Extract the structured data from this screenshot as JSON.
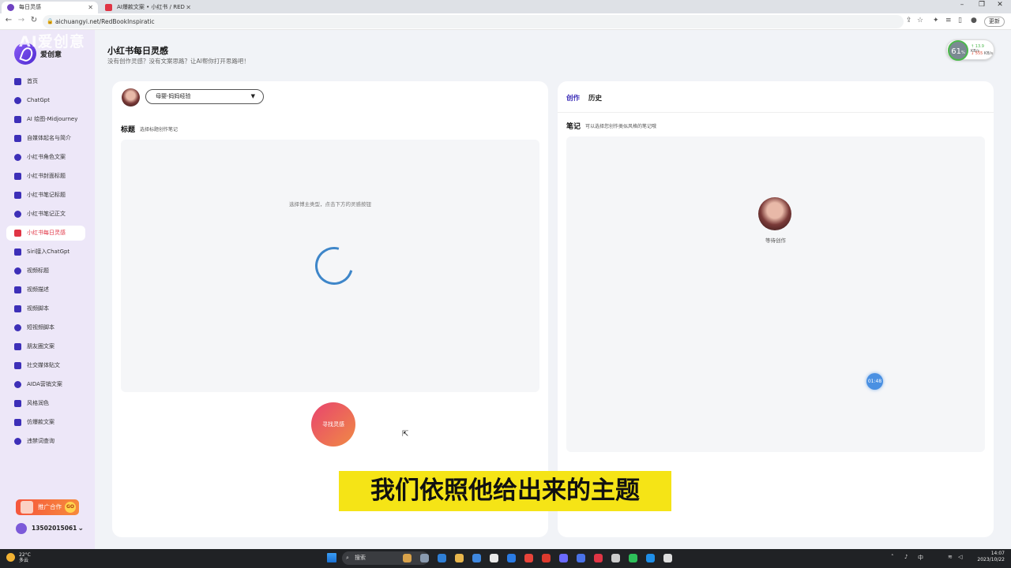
{
  "browser": {
    "tabs": [
      {
        "title": "每日灵感",
        "active": true,
        "icon_color": "#6f42c1"
      },
      {
        "title": "AI爆款文案 • 小红书 / RED",
        "active": false,
        "icon_color": "#e03545"
      }
    ],
    "url": "aichuangyi.net/RedBookInspiratic",
    "update_label": "更新"
  },
  "watermark": "AI爱创意",
  "sidebar": {
    "logo_text": "爱创意",
    "items": [
      {
        "label": "首页",
        "icon": "home-icon",
        "active": false
      },
      {
        "label": "ChatGpt",
        "icon": "chat-icon",
        "active": false
      },
      {
        "label": "AI 绘图-Midjourney",
        "icon": "image-icon",
        "active": false
      },
      {
        "label": "自媒体起名与简介",
        "icon": "pen-icon",
        "active": false
      },
      {
        "label": "小红书角色文案",
        "icon": "book-icon",
        "active": false
      },
      {
        "label": "小红书封面标题",
        "icon": "book-icon",
        "active": false
      },
      {
        "label": "小红书笔记标题",
        "icon": "book-icon",
        "active": false
      },
      {
        "label": "小红书笔记正文",
        "icon": "book-icon",
        "active": false
      },
      {
        "label": "小红书每日灵感",
        "icon": "book-icon",
        "active": true
      },
      {
        "label": "Siri接入ChatGpt",
        "icon": "siri-icon",
        "active": false
      },
      {
        "label": "视频标题",
        "icon": "video-icon",
        "active": false
      },
      {
        "label": "视频描述",
        "icon": "video-icon",
        "active": false
      },
      {
        "label": "视频脚本",
        "icon": "script-icon",
        "active": false
      },
      {
        "label": "短视频脚本",
        "icon": "play-icon",
        "active": false
      },
      {
        "label": "朋友圈文案",
        "icon": "moments-icon",
        "active": false
      },
      {
        "label": "社交媒体贴文",
        "icon": "social-icon",
        "active": false
      },
      {
        "label": "AIDA营销文案",
        "icon": "wifi-icon",
        "active": false
      },
      {
        "label": "风格润色",
        "icon": "wand-icon",
        "active": false
      },
      {
        "label": "仿爆款文案",
        "icon": "fire-icon",
        "active": false
      },
      {
        "label": "违禁词查询",
        "icon": "text-icon",
        "active": false
      }
    ],
    "promo_label": "推广合作",
    "promo_go": "GO",
    "user_phone": "13502015061"
  },
  "page": {
    "title": "小红书每日灵感",
    "subtitle": "没有创作灵感？没有文案思路？让AI帮你打开思路吧！"
  },
  "left_card": {
    "category_value": "母婴-妈妈经验",
    "title_label": "标题",
    "title_hint": "选择标题创作笔记",
    "placeholder": "选择博主类型，点击下方的灵感按钮",
    "find_button": "寻找灵感"
  },
  "right_card": {
    "tabs": [
      "创作",
      "历史"
    ],
    "note_label": "笔记",
    "note_hint": "可以选择您创作类似风格的笔记哦",
    "waiting_text": "等待创作",
    "timer": "01:48"
  },
  "net_widget": {
    "value": "61",
    "unit": "%",
    "up": "↑ 13.9",
    "down": "↓ 555",
    "up_unit": "KB/s",
    "down_unit": "KB/s"
  },
  "subtitle_caption": "我们依照他给出来的主题",
  "taskbar": {
    "weather_temp": "22°C",
    "weather_desc": "多云",
    "search_placeholder": "搜索",
    "ime": "中",
    "time": "14:07",
    "date": "2023/10/22"
  }
}
